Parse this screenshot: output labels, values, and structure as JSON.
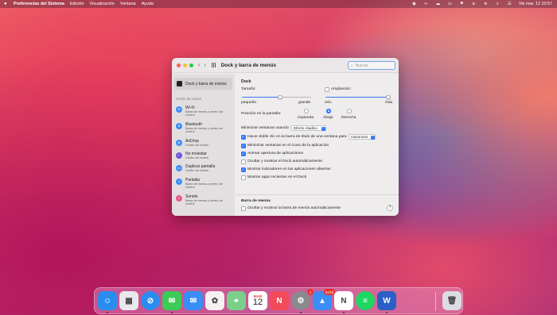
{
  "menubar": {
    "app_name": "Preferencias del Sistema",
    "menus": [
      "Edición",
      "Visualización",
      "Ventana",
      "Ayuda"
    ],
    "clock": "Vie mar. 12  10:57"
  },
  "window": {
    "title": "Dock y barra de menús",
    "search_placeholder": "Buscar"
  },
  "sidebar": {
    "selected": "Dock y barra de menús",
    "section": "Centro de control",
    "items": [
      {
        "title": "Wi-Fi",
        "sub": "Barra de menús y centro de control",
        "color": "#3a8ef6",
        "icon": "wifi-icon",
        "glyph": "≋"
      },
      {
        "title": "Bluetooth",
        "sub": "Barra de menús y centro de control",
        "color": "#3a8ef6",
        "icon": "bluetooth-icon",
        "glyph": "ʙ"
      },
      {
        "title": "AirDrop",
        "sub": "Centro de control",
        "color": "#3a8ef6",
        "icon": "airdrop-icon",
        "glyph": "◎"
      },
      {
        "title": "No molestar",
        "sub": "Centro de control",
        "color": "#6e55d9",
        "icon": "moon-icon",
        "glyph": "☾"
      },
      {
        "title": "Duplicar pantalla",
        "sub": "Centro de control",
        "color": "#3a8ef6",
        "icon": "display-icon",
        "glyph": "▭"
      },
      {
        "title": "Pantalla",
        "sub": "Barra de menús y centro de control",
        "color": "#3a8ef6",
        "icon": "brightness-icon",
        "glyph": "☼"
      },
      {
        "title": "Sonido",
        "sub": "Barra de menús y centro de control",
        "color": "#e85a8c",
        "icon": "speaker-icon",
        "glyph": "♪"
      }
    ]
  },
  "dock_settings": {
    "heading": "Dock",
    "size_label": "Tamaño:",
    "size_min": "pequeño",
    "size_max": "grande",
    "size_value": 0.55,
    "magnification_label": "Ampliación:",
    "mag_min": "mín.",
    "mag_max": "máx.",
    "magnification_value": 1.0,
    "magnification_checked": false,
    "position_label": "Posición en la pantalla:",
    "positions": [
      "Izquierda",
      "Abajo",
      "Derecha"
    ],
    "position_selected": "Abajo",
    "minimize_label": "Minimizar ventanas usando:",
    "minimize_value": "Efecto Aladino",
    "double_click_label": "Hacer doble clic en la barra de título de una ventana para",
    "double_click_value": "maximizar",
    "options": [
      {
        "label": "Minimizar ventanas en el icono de la aplicación",
        "checked": true
      },
      {
        "label": "Animar apertura de aplicaciones",
        "checked": true
      },
      {
        "label": "Ocultar y mostrar el Dock automáticamente",
        "checked": false
      },
      {
        "label": "Mostrar indicadores en las aplicaciones abiertas",
        "checked": true
      },
      {
        "label": "Mostrar apps recientes en el Dock",
        "checked": false
      }
    ]
  },
  "menubar_settings": {
    "heading": "Barra de menús",
    "autohide_label": "Ocultar y mostrar la barra de menús automáticamente",
    "help": "?"
  },
  "dock": {
    "calendar_month": "MAR",
    "calendar_day": "12",
    "prefs_badge": "1",
    "testflight_badge": "8218",
    "apps": [
      {
        "name": "finder-icon",
        "color": "#2b8cf0",
        "glyph": "☺"
      },
      {
        "name": "launchpad-icon",
        "color": "#e8e8ee",
        "glyph": "▦"
      },
      {
        "name": "safari-icon",
        "color": "#2b8cf0",
        "glyph": "⊘"
      },
      {
        "name": "messages-icon",
        "color": "#3ccb56",
        "glyph": "✉"
      },
      {
        "name": "mail-icon",
        "color": "#3a8ef6",
        "glyph": "✉"
      },
      {
        "name": "photos-icon",
        "color": "#f6f0f0",
        "glyph": "✿"
      },
      {
        "name": "maps-icon",
        "color": "#7ad08a",
        "glyph": "⌖"
      },
      {
        "name": "calendar-icon",
        "color": "#ffffff",
        "glyph": ""
      },
      {
        "name": "news-icon",
        "color": "#f14b5a",
        "glyph": "N"
      },
      {
        "name": "settings-icon",
        "color": "#8a8a8e",
        "glyph": "⚙"
      },
      {
        "name": "testflight-icon",
        "color": "#3a8ef6",
        "glyph": "▲"
      },
      {
        "name": "notion-icon",
        "color": "#ffffff",
        "glyph": "N"
      },
      {
        "name": "spotify-icon",
        "color": "#1ed760",
        "glyph": "≡"
      },
      {
        "name": "word-icon",
        "color": "#2b5fc7",
        "glyph": "W"
      },
      {
        "name": "trash-icon",
        "color": "#dcdce2",
        "glyph": "🗑"
      }
    ]
  }
}
